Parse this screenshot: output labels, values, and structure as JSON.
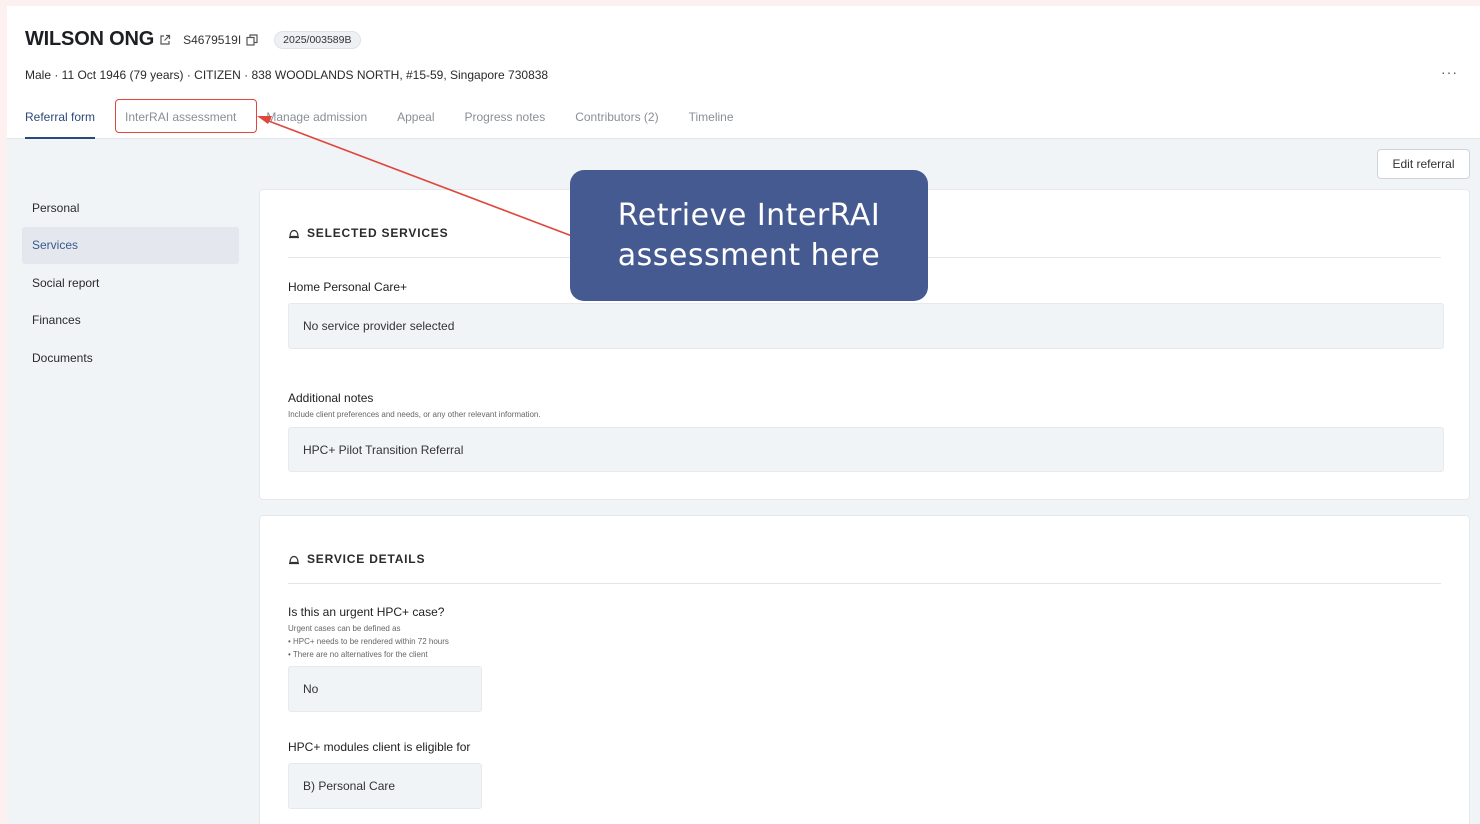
{
  "patient": {
    "name": "WILSON ONG",
    "id": "S4679519I",
    "case_number": "2025/003589B",
    "demographics": "Male · 11 Oct 1946 (79 years) · CITIZEN · 838 WOODLANDS NORTH, #15-59, Singapore 730838",
    "more_label": "···"
  },
  "tabs": [
    {
      "label": "Referral form",
      "active": true
    },
    {
      "label": "InterRAI assessment"
    },
    {
      "label": "Manage admission"
    },
    {
      "label": "Appeal"
    },
    {
      "label": "Progress notes"
    },
    {
      "label": "Contributors (2)"
    },
    {
      "label": "Timeline"
    }
  ],
  "edit_referral_label": "Edit referral",
  "sidebar": {
    "items": [
      {
        "label": "Personal"
      },
      {
        "label": "Services",
        "active": true
      },
      {
        "label": "Social report"
      },
      {
        "label": "Finances"
      },
      {
        "label": "Documents"
      }
    ]
  },
  "selected_services": {
    "title": "SELECTED SERVICES",
    "service_label": "Home Personal Care+",
    "service_value": "No service provider selected",
    "notes_label": "Additional notes",
    "notes_hint": "Include client preferences and needs, or any other relevant information.",
    "notes_value": "HPC+ Pilot Transition Referral"
  },
  "service_details": {
    "title": "SERVICE DETAILS",
    "urgent_label": "Is this an urgent HPC+ case?",
    "urgent_hints": [
      "Urgent cases can be defined as",
      "• HPC+ needs to be rendered within 72 hours",
      "• There are no alternatives for the client"
    ],
    "urgent_value": "No",
    "modules_label": "HPC+ modules client is eligible for",
    "modules_value": "B) Personal Care"
  },
  "annotation": {
    "callout_text": "Retrieve InterRAI assessment here",
    "color": "#e0463c",
    "callout_color": "#465a92"
  },
  "colors": {
    "accent": "#2b4a7a",
    "background": "#f1f4f7"
  }
}
